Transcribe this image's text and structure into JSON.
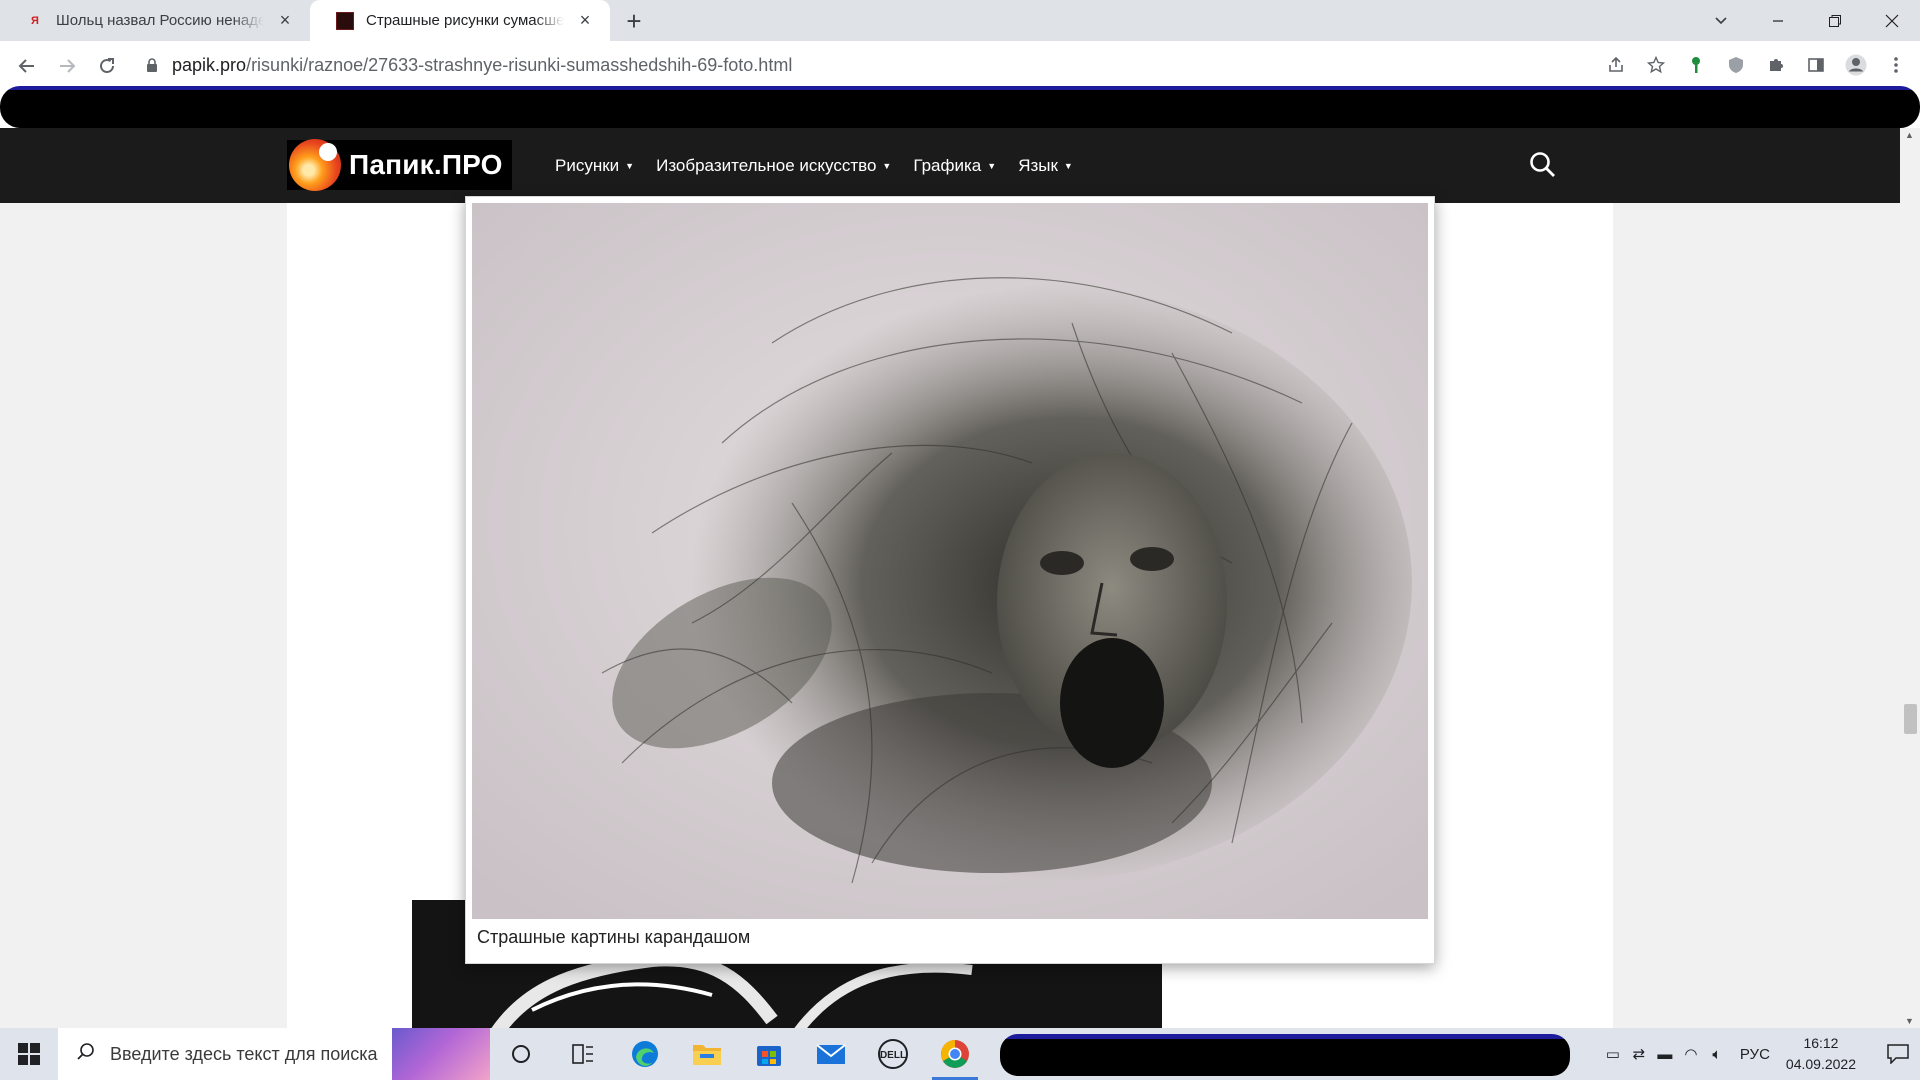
{
  "browser": {
    "tabs": [
      {
        "title": "Шольц назвал Россию ненадежным партнером",
        "favicon": "yandex-news-icon",
        "active": false
      },
      {
        "title": "Страшные рисунки сумасшедших",
        "favicon": "papik-icon",
        "active": true
      }
    ],
    "new_tab_label": "+",
    "url_domain": "papik.pro",
    "url_path": "/risunki/raznoe/27633-strashnye-risunki-sumasshedshih-69-foto.html",
    "window_controls": [
      "chevron-down-icon",
      "minimize-icon",
      "restore-icon",
      "close-icon"
    ]
  },
  "site": {
    "logo_text": "Папик.ПРО",
    "menu": [
      {
        "label": "Рисунки"
      },
      {
        "label": "Изобразительное искусство"
      },
      {
        "label": "Графика"
      },
      {
        "label": "Язык"
      }
    ],
    "accent_color": "#1b1b1b"
  },
  "lightbox": {
    "caption": "Страшные картины карандашом"
  },
  "taskbar": {
    "search_placeholder": "Введите здесь текст для поиска",
    "language": "РУС",
    "time": "16:12",
    "date": "04.09.2022",
    "apps": [
      "task-view-circle-icon",
      "task-view-icon",
      "edge-icon",
      "file-explorer-icon",
      "store-icon",
      "mail-icon",
      "dell-icon",
      "chrome-icon"
    ]
  }
}
